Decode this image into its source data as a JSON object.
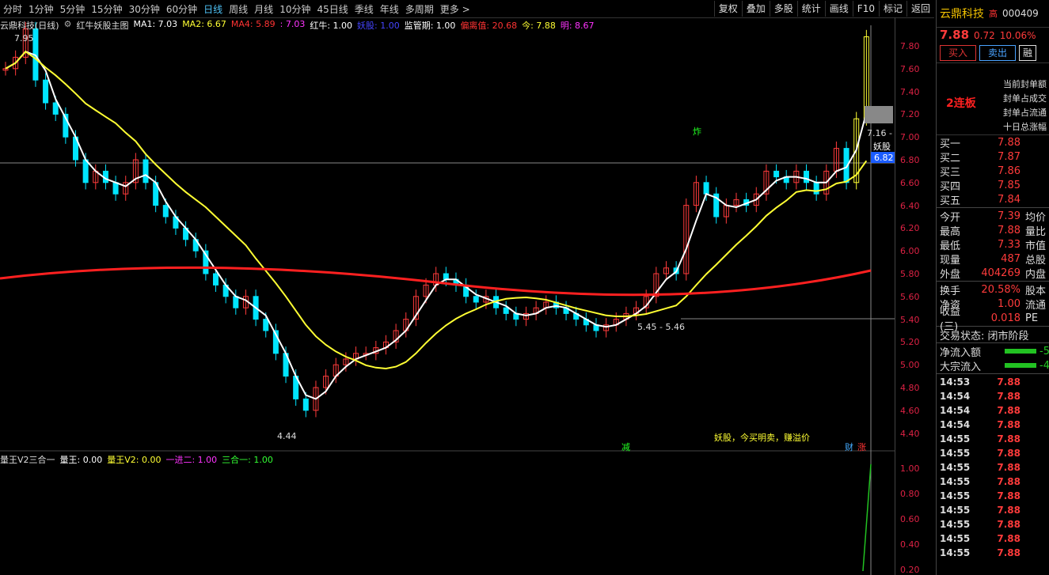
{
  "toolbar": {
    "timeframes": [
      "分时",
      "1分钟",
      "5分钟",
      "15分钟",
      "30分钟",
      "60分钟",
      "日线",
      "周线",
      "月线",
      "10分钟",
      "45日线",
      "季线",
      "年线",
      "多周期",
      "更多 >"
    ],
    "active": "日线",
    "right_buttons": [
      "复权",
      "叠加",
      "多股",
      "统计",
      "画线",
      "F10",
      "标记",
      "返回"
    ]
  },
  "legend": {
    "title": "云鼎科技(日线)",
    "indicator": "红牛妖股主图",
    "ma1": "MA1: 7.03",
    "ma2": "MA2: 6.67",
    "ma4": "MA4: 5.89",
    "v703": ": 7.03",
    "hongniu": "红牛: 1.00",
    "yaogu": "妖股: 1.00",
    "jianguan": "监管期: 1.00",
    "pianli": "偏离值: 20.68",
    "jin": "今: 7.88",
    "ming": "明: 8.67"
  },
  "chart_annotations": {
    "high_label": "7.95",
    "low_label": "4.44",
    "range_label": "5.45 - 5.46",
    "zha": "炸",
    "jian": "减",
    "yaogu_tag": "妖股",
    "price716": "7.16 -",
    "tip": "妖股，今买明卖，赚溢价",
    "cai": "财",
    "zhang": "涨",
    "price_marker": "6.82"
  },
  "y_axis": [
    "7.80",
    "7.60",
    "7.40",
    "7.20",
    "7.00",
    "6.80",
    "6.60",
    "6.40",
    "6.20",
    "6.00",
    "5.80",
    "5.60",
    "5.40",
    "5.20",
    "5.00",
    "4.80",
    "4.60",
    "4.40"
  ],
  "sub_legend": {
    "name": "量王V2三合一",
    "lw": "量王: 0.00",
    "lw2": "量王V2: 0.00",
    "yj": "一进二: 1.00",
    "shy": "三合一: 1.00"
  },
  "sub_axis": [
    "1.00",
    "0.80",
    "0.60",
    "0.40",
    "0.20"
  ],
  "panel": {
    "name": "云鼎科技",
    "name_suffix": "高",
    "code": "000409",
    "price": "7.88",
    "change": "0.72",
    "pct": "10.06%",
    "buy": "买入",
    "sell": "卖出",
    "more": "融",
    "limit_tag": "2连板",
    "limit_info": [
      "当前封单额",
      "封单占成交",
      "封单占流通",
      "十日总涨幅"
    ],
    "book": [
      {
        "label": "买一",
        "price": "7.88",
        "vol": ""
      },
      {
        "label": "买二",
        "price": "7.87",
        "vol": ""
      },
      {
        "label": "买三",
        "price": "7.86",
        "vol": ""
      },
      {
        "label": "买四",
        "price": "7.85",
        "vol": ""
      },
      {
        "label": "买五",
        "price": "7.84",
        "vol": ""
      }
    ],
    "stats": [
      {
        "label": "今开",
        "price": "7.39",
        "extra": "均价"
      },
      {
        "label": "最高",
        "price": "7.88",
        "extra": "量比"
      },
      {
        "label": "最低",
        "price": "7.33",
        "extra": "市值"
      },
      {
        "label": "现量",
        "price": "487",
        "extra": "总股"
      },
      {
        "label": "外盘",
        "price": "404269",
        "extra": "内盘"
      }
    ],
    "stats2": [
      {
        "label": "换手",
        "price": "20.58%",
        "extra": "股本"
      },
      {
        "label": "净资",
        "price": "1.00",
        "extra": "流通"
      },
      {
        "label": "收益(三)",
        "price": "0.018",
        "extra": "PE"
      }
    ],
    "status": "交易状态: 闭市阶段",
    "flows": [
      {
        "label": "净流入额",
        "v": "-5"
      },
      {
        "label": "大宗流入",
        "v": "-4"
      }
    ],
    "ticks": [
      {
        "t": "14:53",
        "p": "7.88"
      },
      {
        "t": "14:54",
        "p": "7.88"
      },
      {
        "t": "14:54",
        "p": "7.88"
      },
      {
        "t": "14:54",
        "p": "7.88"
      },
      {
        "t": "14:55",
        "p": "7.88"
      },
      {
        "t": "14:55",
        "p": "7.88"
      },
      {
        "t": "14:55",
        "p": "7.88"
      },
      {
        "t": "14:55",
        "p": "7.88"
      },
      {
        "t": "14:55",
        "p": "7.88"
      },
      {
        "t": "14:55",
        "p": "7.88"
      },
      {
        "t": "14:55",
        "p": "7.88"
      },
      {
        "t": "14:55",
        "p": "7.88"
      },
      {
        "t": "14:55",
        "p": "7.88"
      }
    ]
  },
  "colors": {
    "up": "#ff3b3b",
    "down": "#00e5ff",
    "ma_white": "#ffffff",
    "ma_yellow": "#ffff33",
    "ma_red": "#ff2020",
    "ma_pink": "#ff33ff"
  }
}
